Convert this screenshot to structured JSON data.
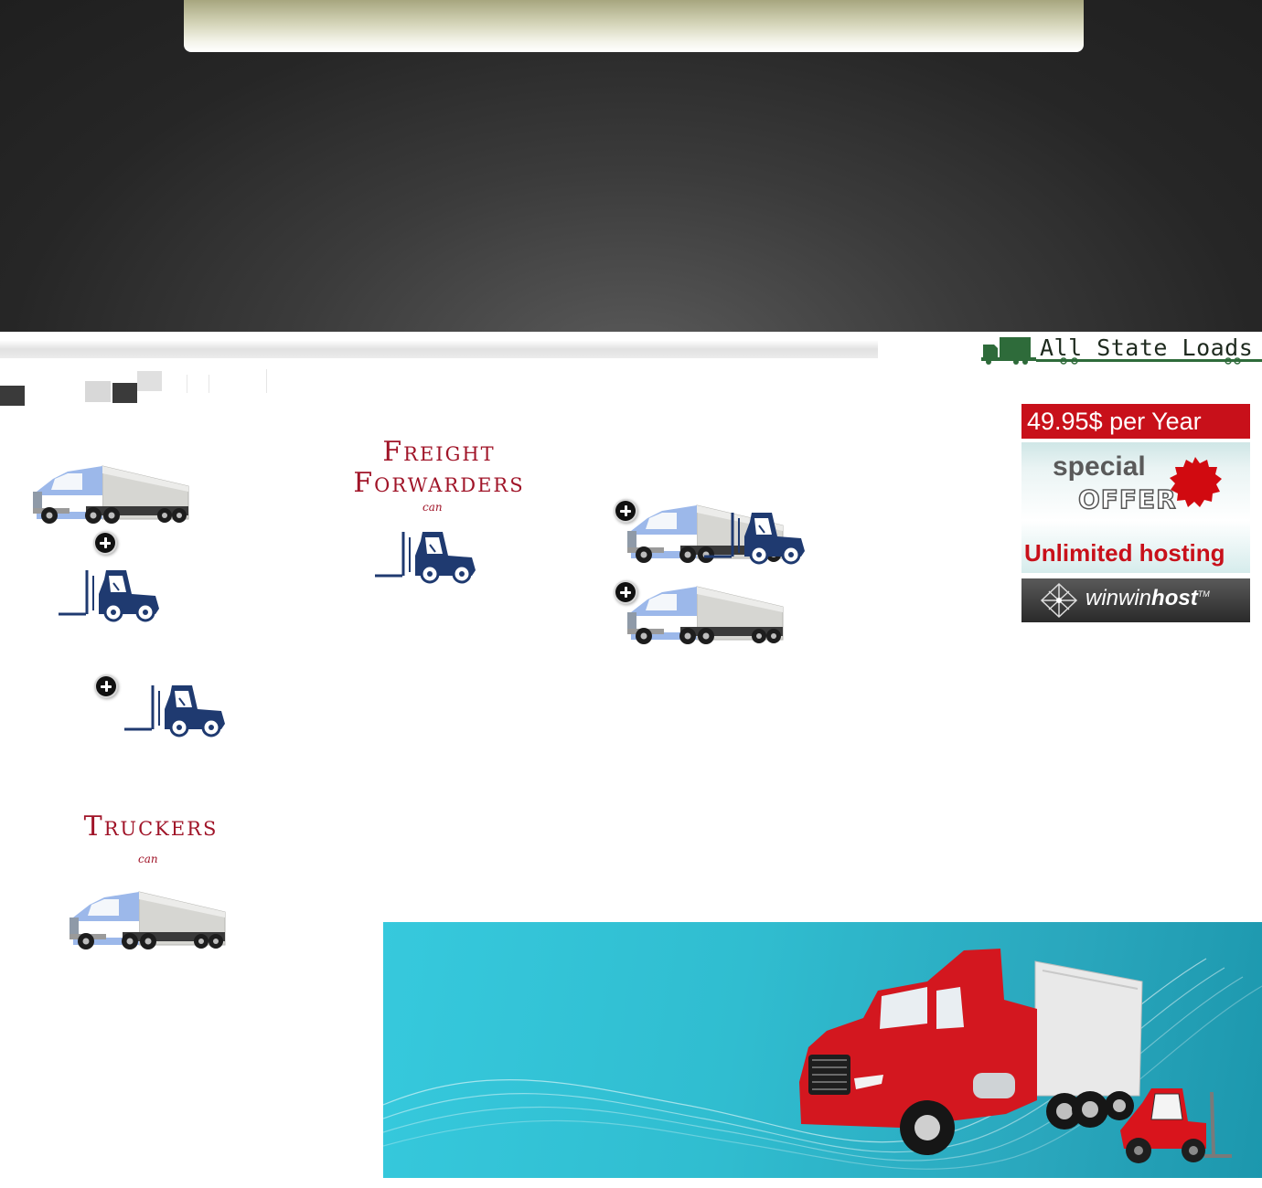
{
  "header": {
    "logo_text": "All State Loads"
  },
  "ad": {
    "price": "49.95$ per Year",
    "special": "special",
    "offer": "OFFER",
    "unlimited": "Unlimited hosting",
    "brand_prefix": "winwin",
    "brand_suffix": "host",
    "trademark": "TM"
  },
  "sections": {
    "freight_title_1": "Freight",
    "freight_title_2": "Forwarders",
    "freight_can": "can",
    "truckers_title": "Truckers",
    "truckers_can": "can"
  },
  "icons": {
    "truck": "truck-icon",
    "forklift": "forklift-icon",
    "plus": "plus-circle-icon"
  },
  "colors": {
    "title_red": "#a01428",
    "ad_red": "#c8101a",
    "logo_green": "#2e6b3a",
    "banner_teal": "#30bdd0"
  }
}
